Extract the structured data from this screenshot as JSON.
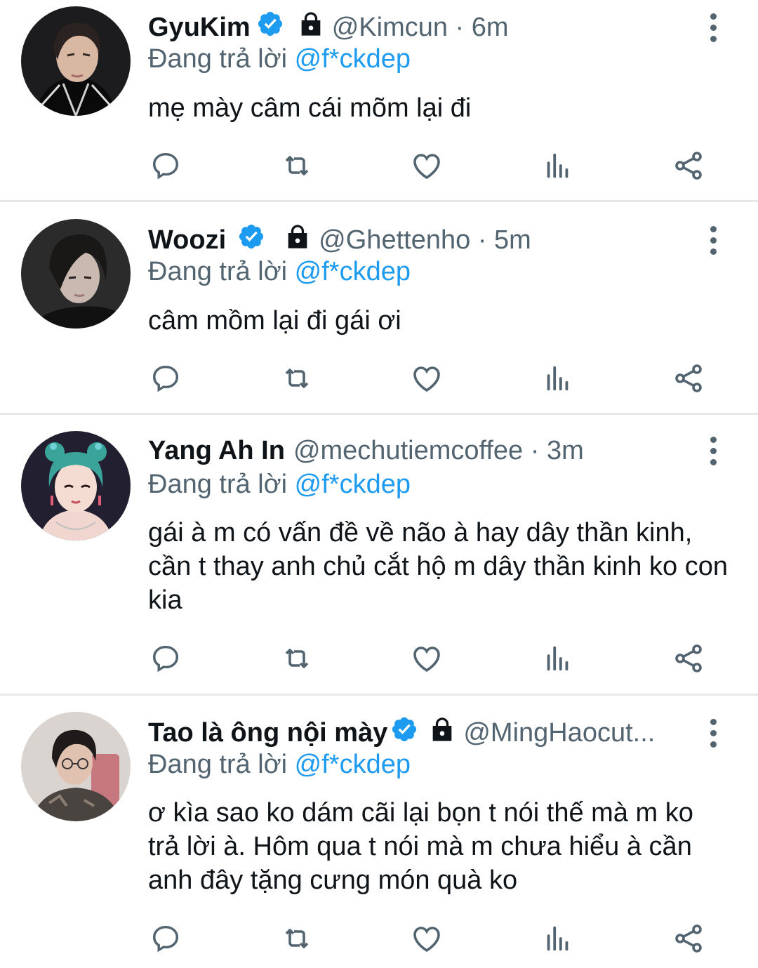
{
  "colors": {
    "accent": "#1d9bf0",
    "secondary_text": "#536471",
    "text": "#0f1419",
    "divider": "#e7e9ea"
  },
  "action_icons": [
    "reply-icon",
    "retweet-icon",
    "like-icon",
    "views-icon",
    "share-icon"
  ],
  "tweets": [
    {
      "name": "GyuKim",
      "verified": true,
      "protected": true,
      "handle_time": "@Kimcun · 6m",
      "replying_prefix": "Đang trả lời",
      "replying_to": "@f*ckdep",
      "text": "mẹ mày câm cái mõm lại đi"
    },
    {
      "name": "Woozi",
      "verified": true,
      "protected": true,
      "handle_time": "@Ghettenho · 5m",
      "replying_prefix": "Đang trả lời",
      "replying_to": "@f*ckdep",
      "text": "câm mồm lại đi gái ơi"
    },
    {
      "name": "Yang Ah In",
      "verified": false,
      "protected": false,
      "handle_time": "@mechutiemcoffee · 3m",
      "replying_prefix": "Đang trả lời",
      "replying_to": "@f*ckdep",
      "text": "gái à m có vấn đề về não à hay dây thần kinh, cần t thay anh chủ cắt hộ m dây thần kinh ko con kia"
    },
    {
      "name": "Tao là ông nội mày",
      "verified": true,
      "protected": true,
      "handle_time": "@MingHaocut...",
      "replying_prefix": "Đang trả lời",
      "replying_to": "@f*ckdep",
      "text": "ơ kìa sao ko dám cãi lại bọn t nói thế mà m ko trả lời à. Hôm qua t nói mà m chưa hiểu à cần anh đây tặng cưng món quà ko"
    }
  ]
}
